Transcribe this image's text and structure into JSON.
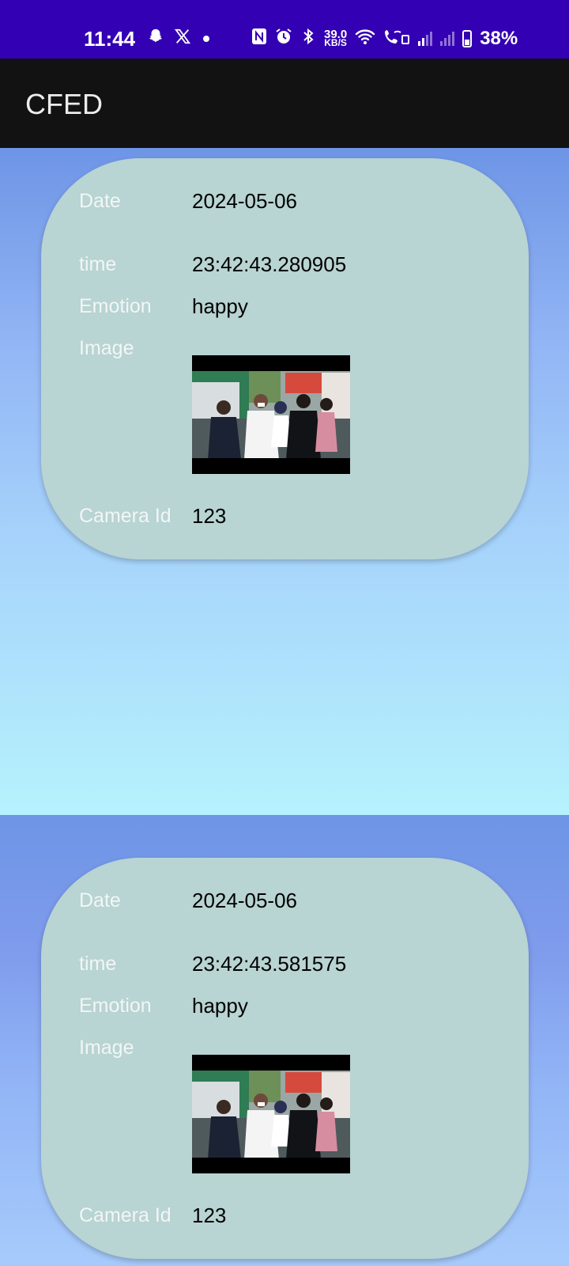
{
  "status_bar": {
    "time": "11:44",
    "icons_left": [
      "snapchat-icon",
      "x-icon",
      "dot-icon"
    ],
    "icons_right": [
      "nfc-icon",
      "alarm-icon",
      "bluetooth-icon",
      "net-speed",
      "wifi-icon",
      "wifi-calling-icon",
      "signal-icon",
      "signal-icon-dim",
      "battery-icon"
    ],
    "net_speed_value": "39.0",
    "net_speed_unit": "KB/S",
    "battery": "38%"
  },
  "app_bar": {
    "title": "CFED"
  },
  "labels": {
    "date": "Date",
    "time": "time",
    "emotion": "Emotion",
    "image": "Image",
    "camera": "Camera Id"
  },
  "records": [
    {
      "date": "2024-05-06",
      "time": "23:42:43.280905",
      "emotion": "happy",
      "image_desc": "photo of people walking",
      "camera_id": "123"
    },
    {
      "date": "2024-05-06",
      "time": "23:42:43.581575",
      "emotion": "happy",
      "image_desc": "photo of people walking",
      "camera_id": "123"
    }
  ],
  "colors": {
    "status_bar": "#3300b3",
    "app_bar": "#121212",
    "card": "#b8d4d3",
    "label": "#f2f6f6",
    "value": "#000000"
  }
}
